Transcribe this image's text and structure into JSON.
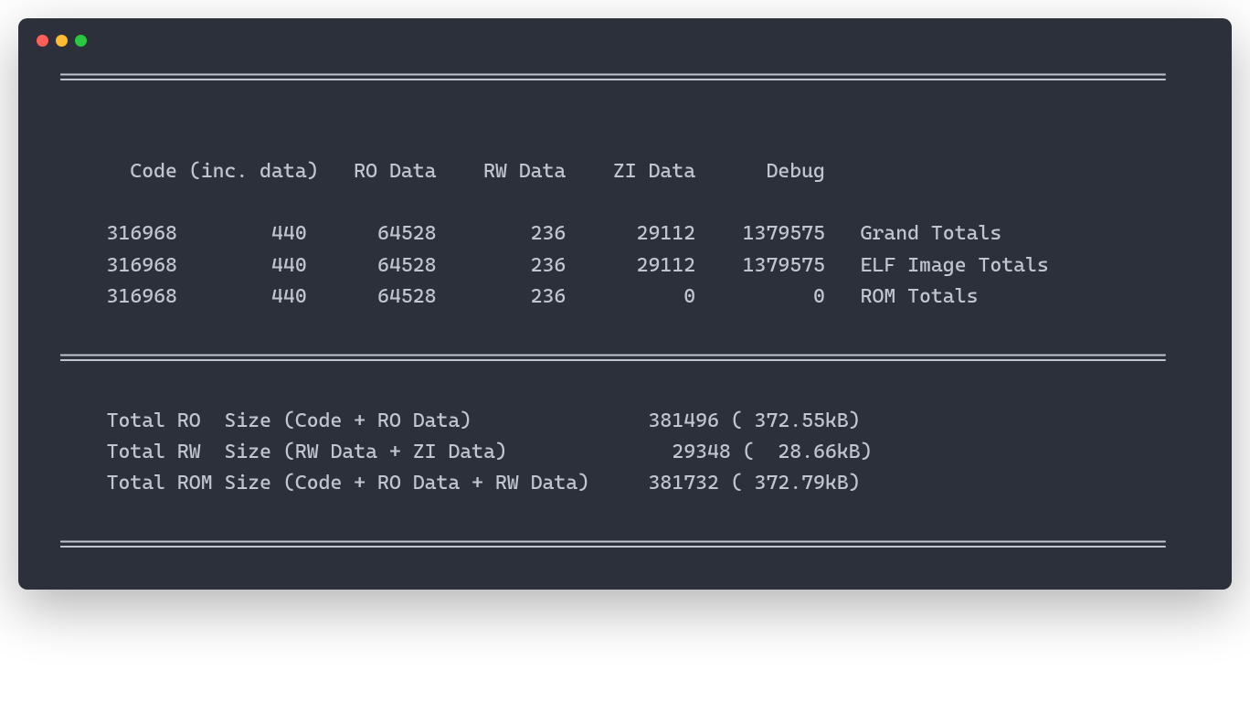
{
  "window": {
    "divider": "=============================================================================================="
  },
  "headers": {
    "code": "Code (inc. data)",
    "ro": "RO Data",
    "rw": "RW Data",
    "zi": "ZI Data",
    "debug": "Debug"
  },
  "rows": [
    {
      "code": "316968",
      "inc": "440",
      "ro": "64528",
      "rw": "236",
      "zi": "29112",
      "debug": "1379575",
      "label": "Grand Totals"
    },
    {
      "code": "316968",
      "inc": "440",
      "ro": "64528",
      "rw": "236",
      "zi": "29112",
      "debug": "1379575",
      "label": "ELF Image Totals"
    },
    {
      "code": "316968",
      "inc": "440",
      "ro": "64528",
      "rw": "236",
      "zi": "0",
      "debug": "0",
      "label": "ROM Totals"
    }
  ],
  "totals": [
    {
      "label": "Total RO  Size (Code + RO Data)",
      "bytes": "381496",
      "pretty": "( 372.55kB)"
    },
    {
      "label": "Total RW  Size (RW Data + ZI Data)",
      "bytes": "29348",
      "pretty": "(  28.66kB)"
    },
    {
      "label": "Total ROM Size (Code + RO Data + RW Data)",
      "bytes": "381732",
      "pretty": "( 372.79kB)"
    }
  ]
}
